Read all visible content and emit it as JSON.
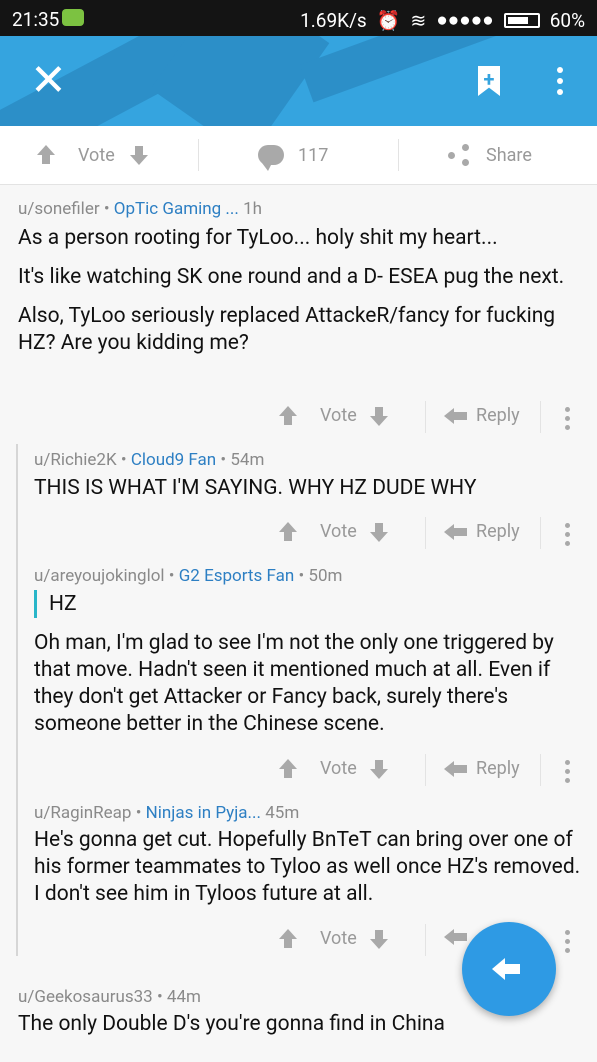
{
  "status": {
    "time": "21:35",
    "speed": "1.69K/s",
    "battery": "60%"
  },
  "post_actions": {
    "vote": "Vote",
    "comments_count": "117",
    "share": "Share"
  },
  "comment_actions": {
    "vote": "Vote",
    "reply": "Reply"
  },
  "comments": [
    {
      "user": "u/sonefiler",
      "flair": "OpTic Gaming ...",
      "time": "1h",
      "paragraphs": [
        "As a person rooting for TyLoo... holy shit my heart...",
        "It's like watching SK one round and a D- ESEA pug the next.",
        "Also, TyLoo seriously replaced AttackeR/fancy for fucking HZ? Are you kidding me?"
      ]
    },
    {
      "user": "u/Richie2K",
      "flair": "Cloud9 Fan",
      "time": "54m",
      "paragraphs": [
        "THIS IS WHAT I'M SAYING. WHY HZ DUDE WHY"
      ]
    },
    {
      "user": "u/areyoujokinglol",
      "flair": "G2 Esports Fan",
      "time": "50m",
      "quote": "HZ",
      "paragraphs": [
        "Oh man, I'm glad to see I'm not the only one triggered by that move. Hadn't seen it mentioned much at all. Even if they don't get Attacker or Fancy back, surely there's someone better in the Chinese scene."
      ]
    },
    {
      "user": "u/RaginReap",
      "flair": "Ninjas in Pyja...",
      "time": "45m",
      "paragraphs": [
        "He's gonna get cut. Hopefully BnTeT can bring over one of his former teammates to Tyloo as well once HZ's removed. I don't see him in Tyloos future at all."
      ]
    },
    {
      "user": "u/Geekosaurus33",
      "flair": "",
      "time": "44m",
      "paragraphs": [
        "The only Double D's you're gonna find in China"
      ]
    }
  ]
}
